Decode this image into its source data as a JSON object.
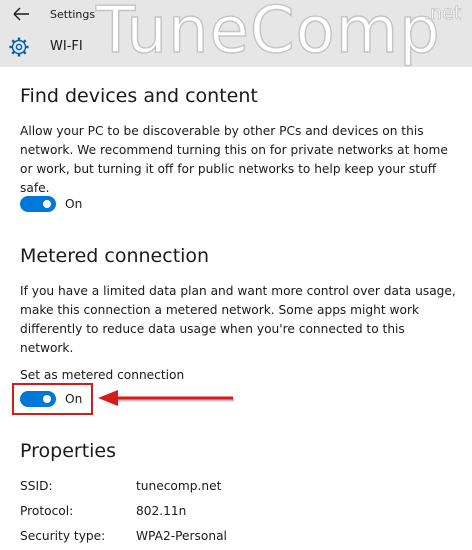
{
  "window": {
    "title": "Settings",
    "page_title": "WI-FI"
  },
  "watermark": {
    "text": "TuneComp",
    "tld": ".net"
  },
  "find_devices": {
    "heading": "Find devices and content",
    "description": "Allow your PC to be discoverable by other PCs and devices on this network. We recommend turning this on for private networks at home or work, but turning it off for public networks to help keep your stuff safe.",
    "toggle_state": "On"
  },
  "metered": {
    "heading": "Metered connection",
    "description": "If you have a limited data plan and want more control over data usage, make this connection a metered network. Some apps might work differently to reduce data usage when you're connected to this network.",
    "setting_label": "Set as metered connection",
    "toggle_state": "On"
  },
  "properties": {
    "heading": "Properties",
    "rows": [
      {
        "key": "SSID:",
        "value": "tunecomp.net"
      },
      {
        "key": "Protocol:",
        "value": "802.11n"
      },
      {
        "key": "Security type:",
        "value": "WPA2-Personal"
      }
    ]
  },
  "colors": {
    "accent": "#0078d7",
    "header_bg": "#e6e6e6",
    "annotation": "#d91a1a"
  }
}
